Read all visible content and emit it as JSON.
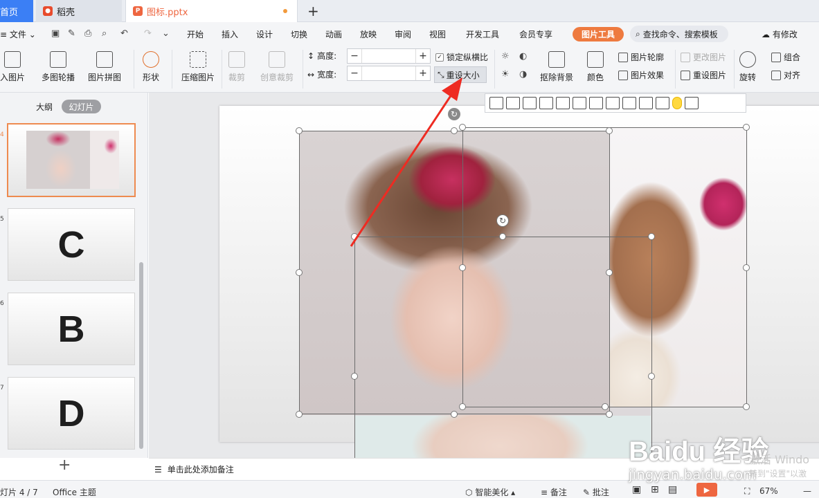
{
  "tabs": {
    "home": "首页",
    "daoke": "稻壳",
    "file": "图标.pptx",
    "add": "+"
  },
  "menu": {
    "file_label": "文件",
    "items": [
      "开始",
      "插入",
      "设计",
      "切换",
      "动画",
      "放映",
      "审阅",
      "视图",
      "开发工具",
      "会员专享"
    ],
    "picture_tools": "图片工具",
    "search_placeholder": "查找命令、搜索模板",
    "has_changes": "有修改"
  },
  "ribbon": {
    "insert_picture": "入图片",
    "multi_outline": "多图轮播",
    "collage": "图片拼图",
    "shape": "形状",
    "compress": "压缩图片",
    "crop": "裁剪",
    "creative_crop": "创意裁剪",
    "height_label": "高度:",
    "width_label": "宽度:",
    "minus": "−",
    "plus": "+",
    "lock_ratio": "锁定纵横比",
    "reset_size": "重设大小",
    "remove_bg": "抠除背景",
    "color": "颜色",
    "picture_outline": "图片轮廓",
    "picture_effect": "图片效果",
    "change_picture": "更改图片",
    "reset_picture": "重设图片",
    "rotate": "旋转",
    "group": "组合",
    "align": "对齐"
  },
  "left_panel": {
    "outline_tab": "大纲",
    "slides_tab": "幻灯片",
    "thumbnails": [
      {
        "num": "4",
        "letter": ""
      },
      {
        "num": "5",
        "letter": "C"
      },
      {
        "num": "6",
        "letter": "B"
      },
      {
        "num": "7",
        "letter": "D"
      }
    ],
    "add": "+"
  },
  "notes": {
    "placeholder": "单击此处添加备注"
  },
  "status": {
    "slide_info": "灯片 4 / 7",
    "theme": "Office 主题",
    "smart_beautify": "智能美化",
    "notes": "备注",
    "comments": "批注",
    "zoom": "67%",
    "zoom_minus": "—"
  },
  "watermark": {
    "brand": "Baidu 经验",
    "url": "jingyan.baidu.com"
  },
  "windows_activation": {
    "line1": "激活 Windo",
    "line2": "转到\"设置\"以激"
  },
  "colors": {
    "accent_orange": "#ee7a3f",
    "tab_blue": "#3b7ff5",
    "arrow_red": "#ee2b22"
  }
}
